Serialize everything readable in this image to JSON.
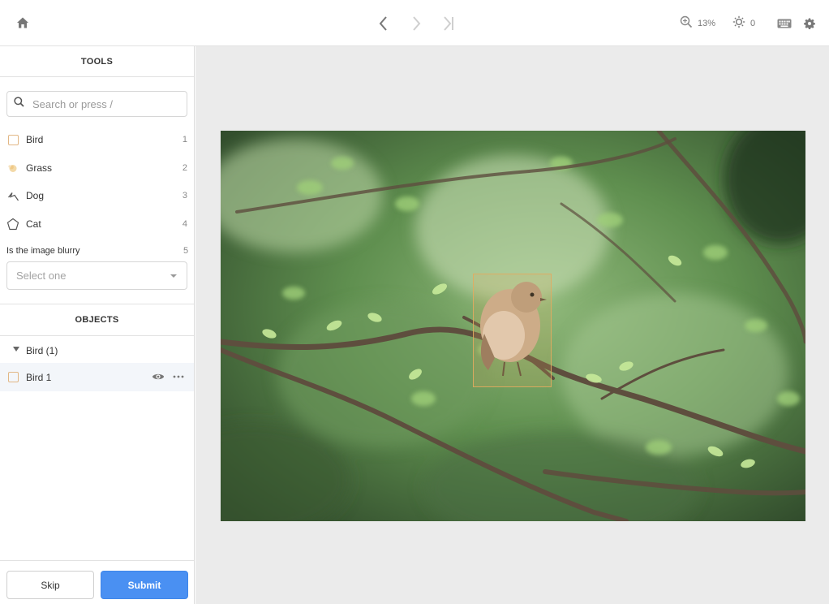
{
  "topbar": {
    "zoom_level": "13%",
    "brightness_value": "0"
  },
  "tools": {
    "title": "TOOLS",
    "search_placeholder": "Search or press /",
    "items": [
      {
        "label": "Bird",
        "key": "1",
        "icon": "bounding-box-icon"
      },
      {
        "label": "Grass",
        "key": "2",
        "icon": "brush-icon"
      },
      {
        "label": "Dog",
        "key": "3",
        "icon": "polyline-icon"
      },
      {
        "label": "Cat",
        "key": "4",
        "icon": "polygon-icon"
      }
    ],
    "question": {
      "label": "Is the image blurry",
      "key": "5",
      "placeholder": "Select one"
    }
  },
  "objects": {
    "title": "OBJECTS",
    "group_label": "Bird (1)",
    "items": [
      {
        "label": "Bird 1"
      }
    ]
  },
  "footer": {
    "skip_label": "Skip",
    "submit_label": "Submit"
  },
  "colors": {
    "accent_blue": "#4a90f2",
    "box_color": "#e2aa5f",
    "canvas_bg": "#ebebeb"
  }
}
